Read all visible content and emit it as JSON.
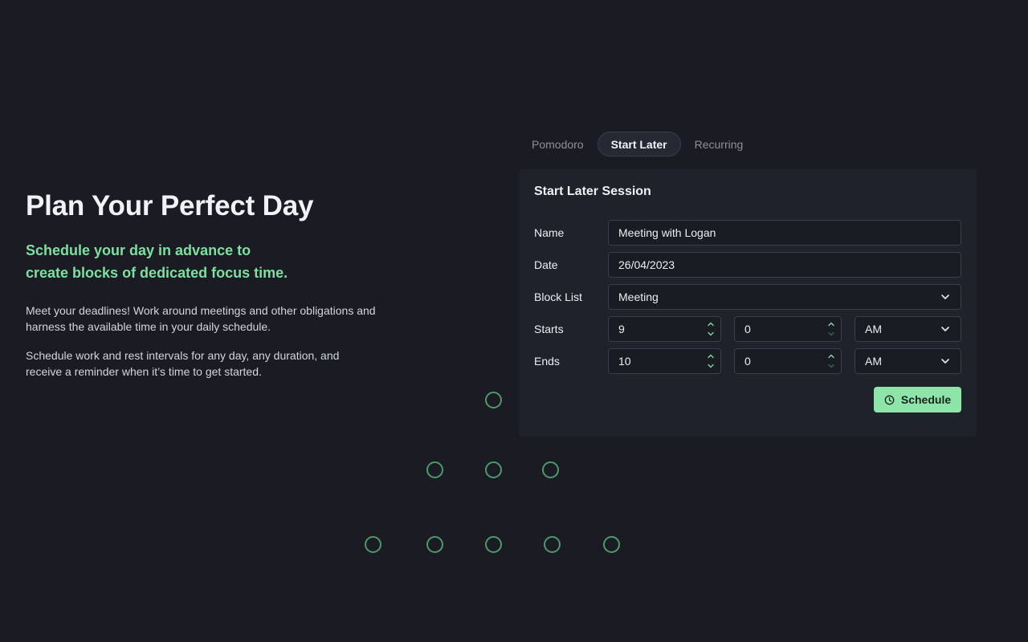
{
  "hero": {
    "title": "Plan Your Perfect Day",
    "subtitle_line1": "Schedule your day in advance to",
    "subtitle_line2": "create blocks of dedicated focus time.",
    "paragraph1": "Meet your deadlines! Work around meetings and other obligations and harness the available time in your daily schedule.",
    "paragraph2": "Schedule work and rest intervals for any day, any duration, and receive a reminder when it’s time to get started."
  },
  "tabs": [
    {
      "label": "Pomodoro",
      "active": false
    },
    {
      "label": "Start Later",
      "active": true
    },
    {
      "label": "Recurring",
      "active": false
    }
  ],
  "form": {
    "title": "Start Later Session",
    "name": {
      "label": "Name",
      "value": "Meeting with Logan"
    },
    "date": {
      "label": "Date",
      "value": "26/04/2023"
    },
    "block_list": {
      "label": "Block List",
      "value": "Meeting"
    },
    "starts": {
      "label": "Starts",
      "hour": "9",
      "minute": "0",
      "period": "AM"
    },
    "ends": {
      "label": "Ends",
      "hour": "10",
      "minute": "0",
      "period": "AM"
    },
    "submit_label": "Schedule"
  },
  "icons": {
    "schedule_button": "clock-icon",
    "select": "chevron-down-icon",
    "stepper_up": "chevron-up-icon",
    "stepper_down": "chevron-down-icon"
  },
  "colors": {
    "background": "#1a1b23",
    "card": "#20222b",
    "accent": "#8ee5a9",
    "subtitle": "#7ee0a0",
    "circle": "#4c9a6b"
  }
}
